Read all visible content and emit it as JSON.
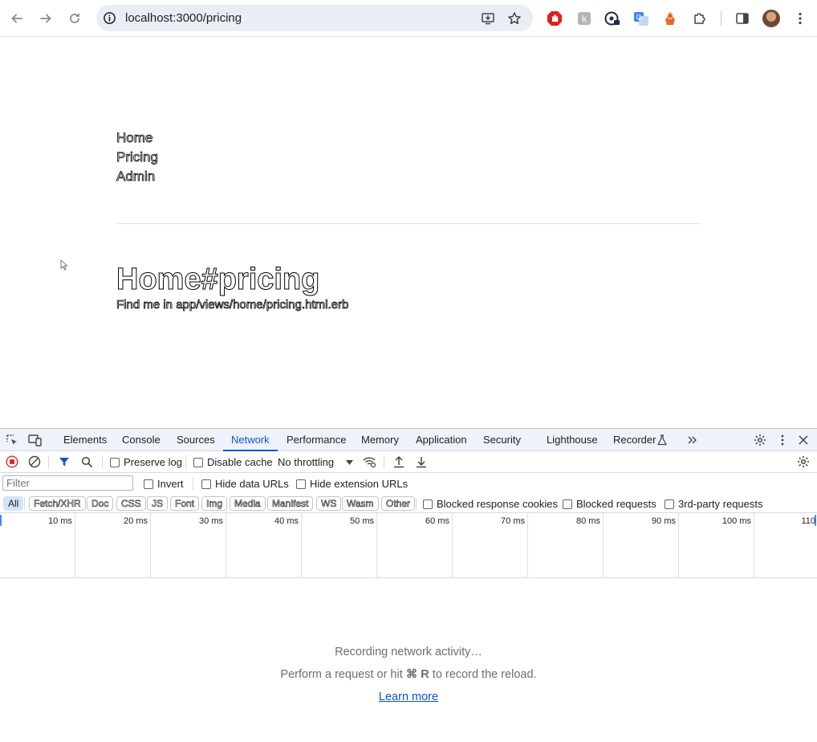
{
  "browser": {
    "url": "localhost:3000/pricing",
    "back_icon": "arrow-left",
    "forward_icon": "arrow-right",
    "reload_icon": "reload"
  },
  "page": {
    "nav_links": [
      "Home",
      "Pricing",
      "Admin"
    ],
    "title": "Home#pricing",
    "description": "Find me in app/views/home/pricing.html.erb"
  },
  "devtools": {
    "tabs": [
      {
        "label": "Elements"
      },
      {
        "label": "Console"
      },
      {
        "label": "Sources"
      },
      {
        "label": "Network",
        "active": true
      },
      {
        "label": "Performance"
      },
      {
        "label": "Memory"
      },
      {
        "label": "Application"
      },
      {
        "label": "Security"
      },
      {
        "label": "Lighthouse"
      },
      {
        "label": "Recorder"
      }
    ],
    "network": {
      "preserve_log": "Preserve log",
      "disable_cache": "Disable cache",
      "throttling": "No throttling",
      "filter_placeholder": "Filter",
      "invert": "Invert",
      "hide_data_urls": "Hide data URLs",
      "hide_extension_urls": "Hide extension URLs",
      "type_filters": [
        "All",
        "Fetch/XHR",
        "Doc",
        "CSS",
        "JS",
        "Font",
        "Img",
        "Media",
        "Manifest",
        "WS",
        "Wasm",
        "Other"
      ],
      "blocked_response_cookies": "Blocked response cookies",
      "blocked_requests": "Blocked requests",
      "third_party_requests": "3rd-party requests",
      "timeline_ticks": [
        "10 ms",
        "20 ms",
        "30 ms",
        "40 ms",
        "50 ms",
        "60 ms",
        "70 ms",
        "80 ms",
        "90 ms",
        "100 ms",
        "110"
      ],
      "empty_line1": "Recording network activity…",
      "empty_line2_pre": "Perform a request or hit ",
      "empty_line2_key": "⌘ R",
      "empty_line2_post": " to record the reload.",
      "learn_more": "Learn more"
    },
    "colors": {
      "accent": "#0b57d0",
      "record": "#d93025"
    }
  }
}
